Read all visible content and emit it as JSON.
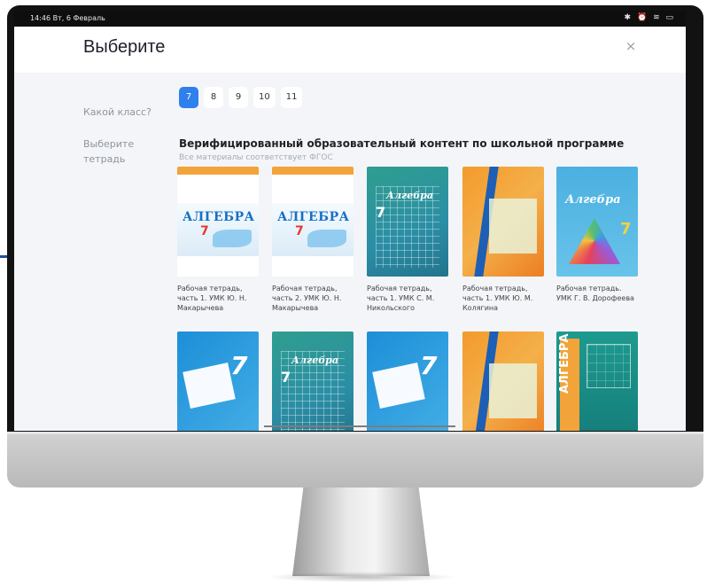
{
  "status_bar": {
    "time": "14:46 Вт, 6 Февраль",
    "icons": [
      "bluetooth-icon",
      "alarm-icon",
      "wifi-icon",
      "battery-icon"
    ]
  },
  "dialog": {
    "title": "Выберите",
    "close_label": "×"
  },
  "grade_selector": {
    "label": "Какой класс?",
    "options": [
      "7",
      "8",
      "9",
      "10",
      "11"
    ],
    "selected": "7"
  },
  "notebook_section": {
    "label": "Выберите тетрадь",
    "heading": "Верифицированный образовательный контент по школьной программе",
    "subheading": "Все материалы соответствует ФГОС"
  },
  "books": [
    {
      "caption": "Рабочая тетрадь, часть 1. УМК Ю. Н. Макарычева",
      "cover_word": "АЛГЕБРА",
      "cover_number": "7"
    },
    {
      "caption": "Рабочая тетрадь, часть 2. УМК Ю. Н. Макарычева",
      "cover_word": "АЛГЕБРА",
      "cover_number": "7"
    },
    {
      "caption": "Рабочая тетрадь, часть 1. УМК С. М. Никольского",
      "cover_word": "Алгебра",
      "cover_number": "7"
    },
    {
      "caption": "Рабочая тетрадь, часть 1. УМК Ю. М. Колягина"
    },
    {
      "caption": "Рабочая тетрадь. УМК Г. В. Дорофеева",
      "cover_word": "Алгебра",
      "cover_number": "7"
    }
  ],
  "books_row2": [
    {
      "cover_number": "7"
    },
    {
      "cover_word": "Алгебра",
      "cover_number": "7"
    },
    {
      "cover_number": "7"
    },
    {},
    {
      "cover_word": "АЛГЕБРА"
    }
  ],
  "colors": {
    "accent": "#2f80ed",
    "connector": "#1f4ea3",
    "panel_bg": "#f3f5f8"
  }
}
